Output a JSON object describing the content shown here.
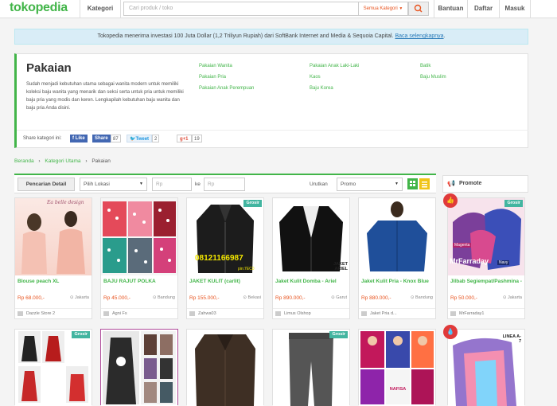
{
  "header": {
    "logo": "tokopedia",
    "kategori_label": "Kategori",
    "search_placeholder": "Cari produk / toko",
    "search_category": "Semua Kategori",
    "nav": [
      "Bantuan",
      "Daftar",
      "Masuk"
    ]
  },
  "notice": {
    "text": "Tokopedia menerima investasi 100 Juta Dollar (1,2 Triliyun Rupiah) dari SoftBank Internet and Media & Sequoia Capital.",
    "link": "Baca selengkapnya",
    "suffix": "."
  },
  "category": {
    "title": "Pakaian",
    "description": "Sudah menjadi kebutuhan utama sebagai wanita modern untuk memiliki koleksi baju wanita yang menarik dan seksi serta untuk pria untuk memiliki baju pria yang modis dan keren. Lengkapilah kebutuhan baju wanita dan baju pria Anda disini.",
    "links": [
      "Pakaian Wanita",
      "Pakaian Pria",
      "Pakaian Anak Perempuan",
      "Pakaian Anak Laki-Laki",
      "Kaos",
      "Baju Korea",
      "Batik",
      "Baju Muslim"
    ],
    "share_label": "Share kategori ini:",
    "like_label": "Like",
    "share_btn": "Share",
    "share_count": "87",
    "tweet_label": "Tweet",
    "tweet_count": "2",
    "gplus_label": "+1",
    "gplus_count": "19"
  },
  "breadcrumb": {
    "items": [
      "Beranda",
      "Kategori Utama",
      "Pakaian"
    ],
    "separator": "›"
  },
  "filters": {
    "detail_button": "Pencarian Detail",
    "location_placeholder": "Pilih Lokasi",
    "price_min_placeholder": "Rp",
    "between": "ke",
    "price_max_placeholder": "Rp",
    "sort_label": "Urutkan",
    "sort_value": "Promo"
  },
  "promote": {
    "title": "Promote"
  },
  "products": [
    {
      "name": "Blouse peach XL",
      "price": "Rp 68.000,-",
      "location": "Jakarta",
      "shop": "Dazzle Store 2",
      "grosir": ""
    },
    {
      "name": "BAJU RAJUT POLKA",
      "price": "Rp 45.000,-",
      "location": "Bandung",
      "shop": "Agni Fs",
      "grosir": ""
    },
    {
      "name": "JAKET KULIT (carlit)",
      "price": "Rp 155.000,-",
      "location": "Bekasi",
      "shop": "Zahwa03",
      "grosir": "Grosir"
    },
    {
      "name": "Jaket Kulit Domba - Ariel",
      "price": "Rp 890.000,-",
      "location": "Garut",
      "shop": "Limus Olshop",
      "grosir": ""
    },
    {
      "name": "Jaket Kulit Pria - Knox Blue",
      "price": "Rp 880.000,-",
      "location": "Bandung",
      "shop": "Jaket Pria d...",
      "grosir": ""
    },
    {
      "name": "Jilbab Segiempat/Pashmina -",
      "price": "Rp 50.000,-",
      "location": "Jakarta",
      "shop": "MrFarraday1",
      "grosir": "Grosir"
    }
  ],
  "row2": [
    {
      "grosir": "Grosir"
    },
    {
      "grosir": ""
    },
    {
      "grosir": ""
    },
    {
      "grosir": "Grosir"
    },
    {
      "grosir": ""
    },
    {
      "grosir": ""
    }
  ],
  "image_texts": {
    "p1_script": "Ea belle design",
    "p3_phone": "08121166987",
    "p3_pin": "pin:7EC0",
    "p4_mark": "JAKET ARIEL",
    "p6_brand": "MrFarraday",
    "p6_magenta": "Magenta",
    "p6_navy": "Navy",
    "r2_p6_label": "LINEA A-7",
    "r2_p5_nafisa": "NAFISA"
  },
  "colors": {
    "brand_green": "#42b549",
    "price_orange": "#e8531e",
    "notice_bg": "#d9edf7",
    "link_blue": "#2a7ab8"
  },
  "icons": [
    "search-icon",
    "chart-icon",
    "location-icon",
    "shop-icon",
    "thumbs-up-icon",
    "drop-icon",
    "grid-view-icon",
    "list-view-icon",
    "facebook-icon",
    "twitter-icon"
  ]
}
